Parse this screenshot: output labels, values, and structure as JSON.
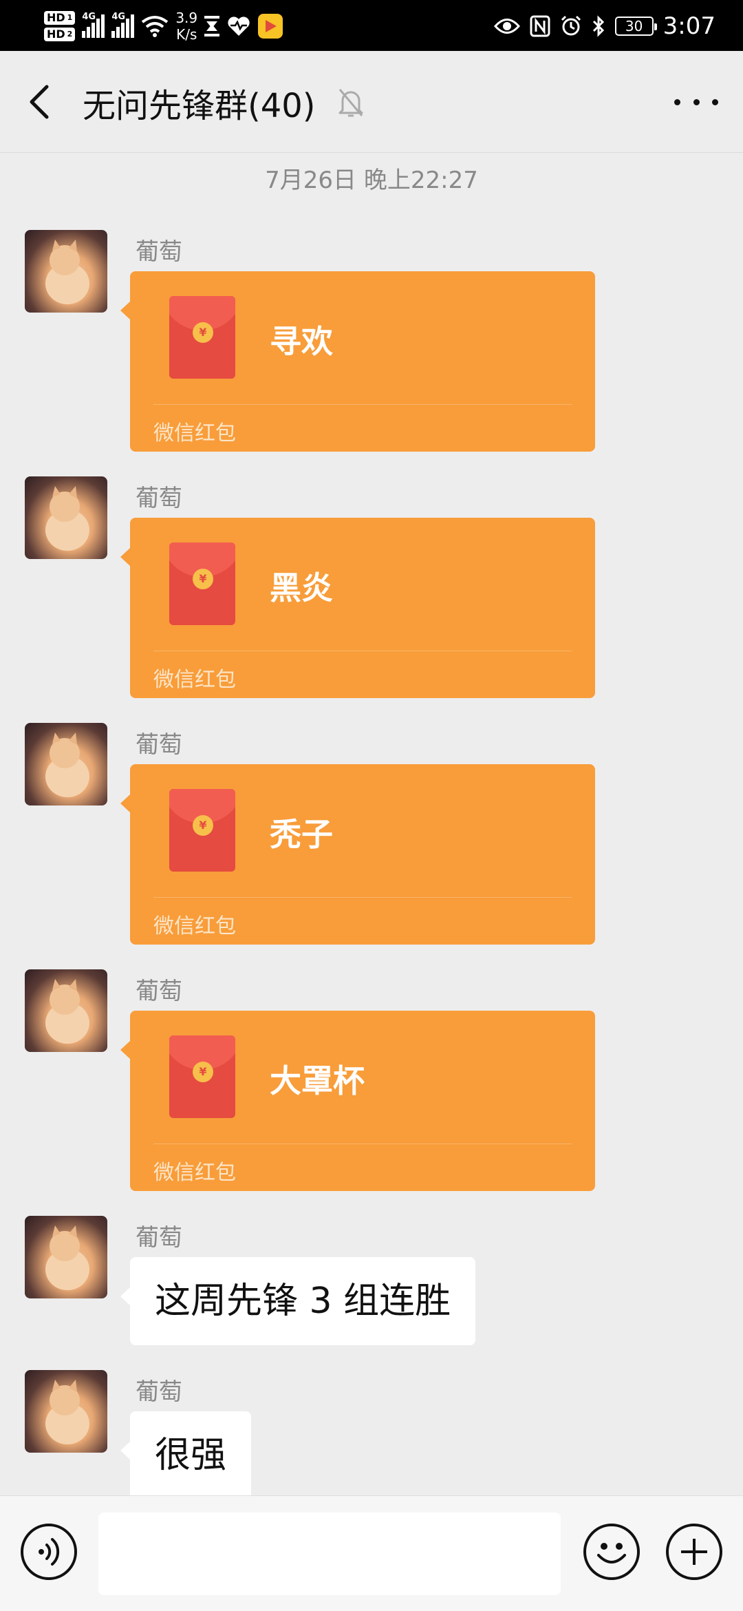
{
  "status_bar": {
    "hd1": "HD",
    "hd1_sub": "1",
    "hd2": "HD",
    "hd2_sub": "2",
    "net1": "4G",
    "net2": "4G",
    "speed_value": "3.9",
    "speed_unit": "K/s",
    "battery": "30",
    "time": "3:07"
  },
  "header": {
    "title": "无问先锋群(40)",
    "muted": true
  },
  "chat": {
    "timestamp": "7月26日 晚上22:27",
    "messages": [
      {
        "sender": "葡萄",
        "type": "red_packet",
        "title": "寻欢",
        "label": "微信红包"
      },
      {
        "sender": "葡萄",
        "type": "red_packet",
        "title": "黑炎",
        "label": "微信红包"
      },
      {
        "sender": "葡萄",
        "type": "red_packet",
        "title": "秃子",
        "label": "微信红包"
      },
      {
        "sender": "葡萄",
        "type": "red_packet",
        "title": "大罩杯",
        "label": "微信红包"
      },
      {
        "sender": "葡萄",
        "type": "text",
        "text": "这周先锋 3 组连胜"
      },
      {
        "sender": "葡萄",
        "type": "text",
        "text": "很强"
      }
    ]
  },
  "input_bar": {
    "value": "",
    "placeholder": ""
  },
  "colors": {
    "red_packet_bg": "#f89d3a",
    "envelope": "#e54b40",
    "chat_bg": "#ededed"
  },
  "icons": [
    "back-arrow-icon",
    "mute-bell-icon",
    "more-dots-icon",
    "voice-icon",
    "emoji-icon",
    "plus-icon"
  ]
}
